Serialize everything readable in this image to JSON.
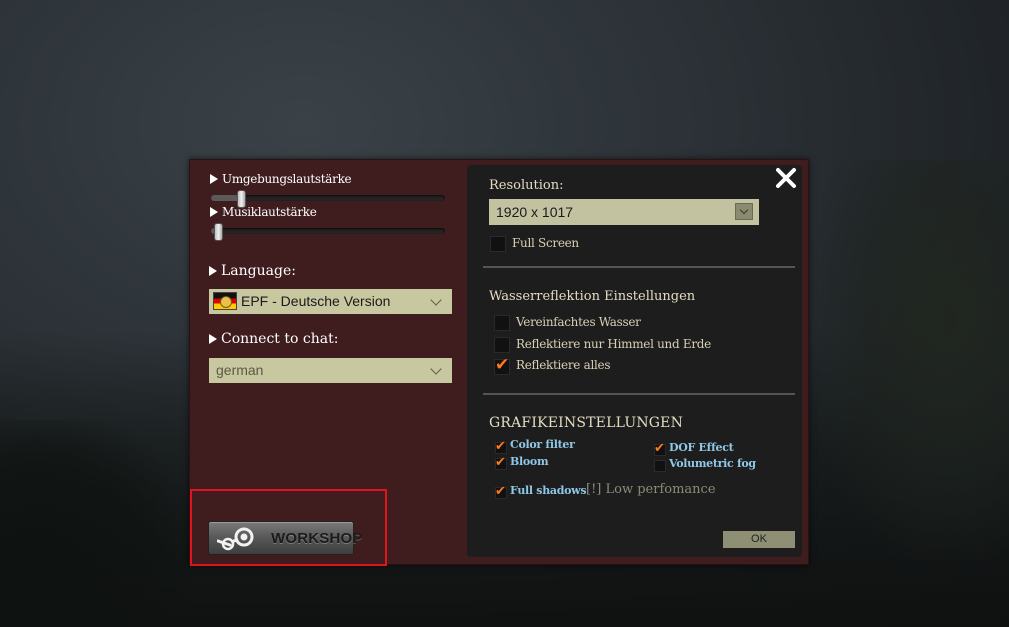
{
  "left": {
    "ambient_volume_label": "Umgebungslautstärke",
    "ambient_volume_value": 0.13,
    "music_volume_label": "Musiklautstärke",
    "music_volume_value": 0.03,
    "language_label": "Language:",
    "language_value": "EPF - Deutsche Version",
    "chat_label": "Connect to chat:",
    "chat_value": "german",
    "workshop_label": "WORKSHOP"
  },
  "right": {
    "resolution_label": "Resolution:",
    "resolution_value": "1920 x 1017",
    "fullscreen_label": "Full Screen",
    "fullscreen_checked": false,
    "water_section_title": "Wasserreflektion Einstellungen",
    "water_options": [
      {
        "label": "Vereinfachtes Wasser",
        "checked": false
      },
      {
        "label": "Reflektiere nur Himmel und Erde",
        "checked": false
      },
      {
        "label": "Reflektiere alles",
        "checked": true
      }
    ],
    "graphics_section_title": "GRAFIKEINSTELLUNGEN",
    "graphics_options": [
      {
        "label": "Color filter",
        "checked": true
      },
      {
        "label": "Bloom",
        "checked": true
      },
      {
        "label": "DOF Effect",
        "checked": true
      },
      {
        "label": "Volumetric fog",
        "checked": false
      },
      {
        "label": "Full shadows",
        "checked": true
      }
    ],
    "low_performance_note": "[!] Low perfomance",
    "ok_label": "OK"
  },
  "colors": {
    "dialog_bg": "#3f1c1e",
    "panel_bg": "#1d1d1d",
    "check_orange": "#ff7a1a",
    "graphics_label_blue": "#8fc7e6",
    "highlight_red": "#e0141c"
  },
  "icons": {
    "close": "close-icon",
    "steam": "steam-icon",
    "flag": "german-flag-icon",
    "checkmark": "checkmark-icon"
  }
}
